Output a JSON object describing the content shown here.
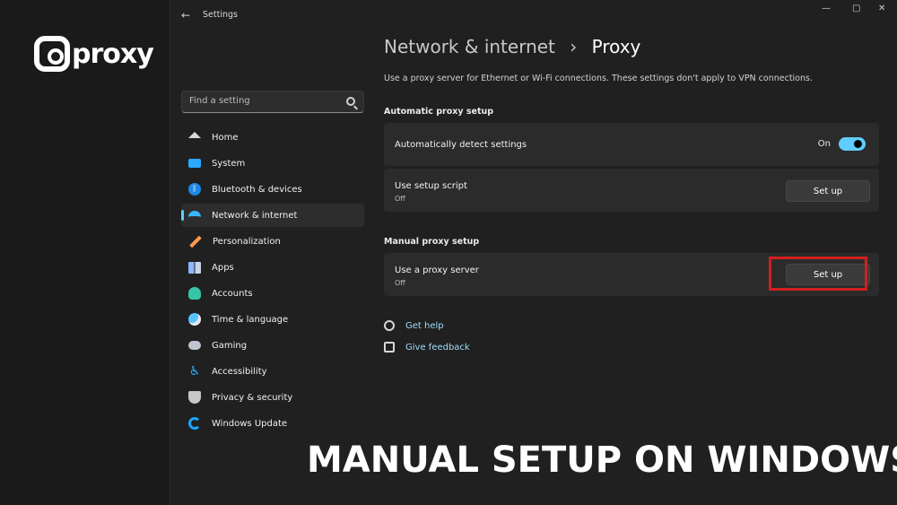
{
  "brand": {
    "name": "proxy"
  },
  "window": {
    "title": "Settings",
    "back_icon": "back-arrow-icon",
    "controls": [
      "—",
      "▢",
      "✕"
    ]
  },
  "sidebar": {
    "search_placeholder": "Find a setting",
    "items": [
      {
        "label": "Home",
        "icon": "home-icon",
        "color": "#d9d9d9"
      },
      {
        "label": "System",
        "icon": "system-icon",
        "color": "#2aa9ff"
      },
      {
        "label": "Bluetooth & devices",
        "icon": "bluetooth-icon",
        "color": "#1e88e5"
      },
      {
        "label": "Network & internet",
        "icon": "wifi-icon",
        "color": "#39b6ff"
      },
      {
        "label": "Personalization",
        "icon": "brush-icon",
        "color": "#ff9a4d"
      },
      {
        "label": "Apps",
        "icon": "apps-icon",
        "color": "#8fb6ff"
      },
      {
        "label": "Accounts",
        "icon": "accounts-icon",
        "color": "#37c5a6"
      },
      {
        "label": "Time & language",
        "icon": "clock-globe-icon",
        "color": "#58c2ff"
      },
      {
        "label": "Gaming",
        "icon": "gamepad-icon",
        "color": "#bfc4cf"
      },
      {
        "label": "Accessibility",
        "icon": "accessibility-icon",
        "color": "#1fb0ff"
      },
      {
        "label": "Privacy & security",
        "icon": "shield-icon",
        "color": "#c7c7c7"
      },
      {
        "label": "Windows Update",
        "icon": "update-icon",
        "color": "#1aa5ff"
      }
    ]
  },
  "main": {
    "breadcrumb": {
      "parent": "Network & internet",
      "separator": "›",
      "current": "Proxy"
    },
    "description": "Use a proxy server for Ethernet or Wi-Fi connections. These settings don't apply to VPN connections.",
    "automatic": {
      "section_title": "Automatic proxy setup",
      "detect": {
        "label": "Automatically detect settings",
        "state_label": "On",
        "toggle_on": true
      },
      "script": {
        "label": "Use setup script",
        "status": "Off",
        "button": "Set up"
      }
    },
    "manual": {
      "section_title": "Manual proxy setup",
      "proxy": {
        "label": "Use a proxy server",
        "status": "Off",
        "button": "Set up"
      }
    },
    "links": [
      {
        "label": "Get help",
        "icon": "help-icon"
      },
      {
        "label": "Give feedback",
        "icon": "feedback-icon"
      }
    ]
  },
  "overlay": {
    "text": "MANUAL SETUP ON WINDOWS"
  },
  "colors": {
    "accent": "#60cdff",
    "highlight": "#d11f1f"
  }
}
